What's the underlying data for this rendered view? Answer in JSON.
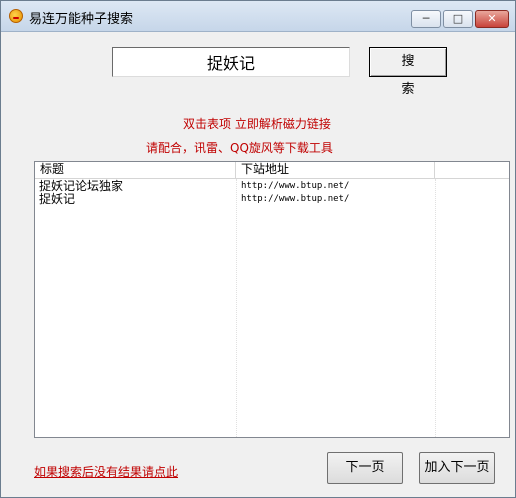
{
  "window": {
    "title": "易连万能种子搜索"
  },
  "titlebar": {
    "minimize": "─",
    "maximize": "□",
    "close": "✕"
  },
  "search": {
    "value": "捉妖记",
    "button_label": "搜 索"
  },
  "hints": {
    "line1": "双击表项 立即解析磁力链接",
    "line2": "请配合，讯雷、QQ旋风等下载工具"
  },
  "table": {
    "columns": [
      "标题",
      "下站地址",
      ""
    ],
    "rows": [
      {
        "title": "捉妖记论坛独家",
        "url": "http://www.btup.net/"
      },
      {
        "title": "捉妖记",
        "url": "http://www.btup.net/"
      }
    ]
  },
  "footer": {
    "no_result_link": "如果搜索后没有结果请点此",
    "next_page": "下一页",
    "add_next_page": "加入下一页"
  },
  "colors": {
    "hint_red": "#c00000"
  }
}
